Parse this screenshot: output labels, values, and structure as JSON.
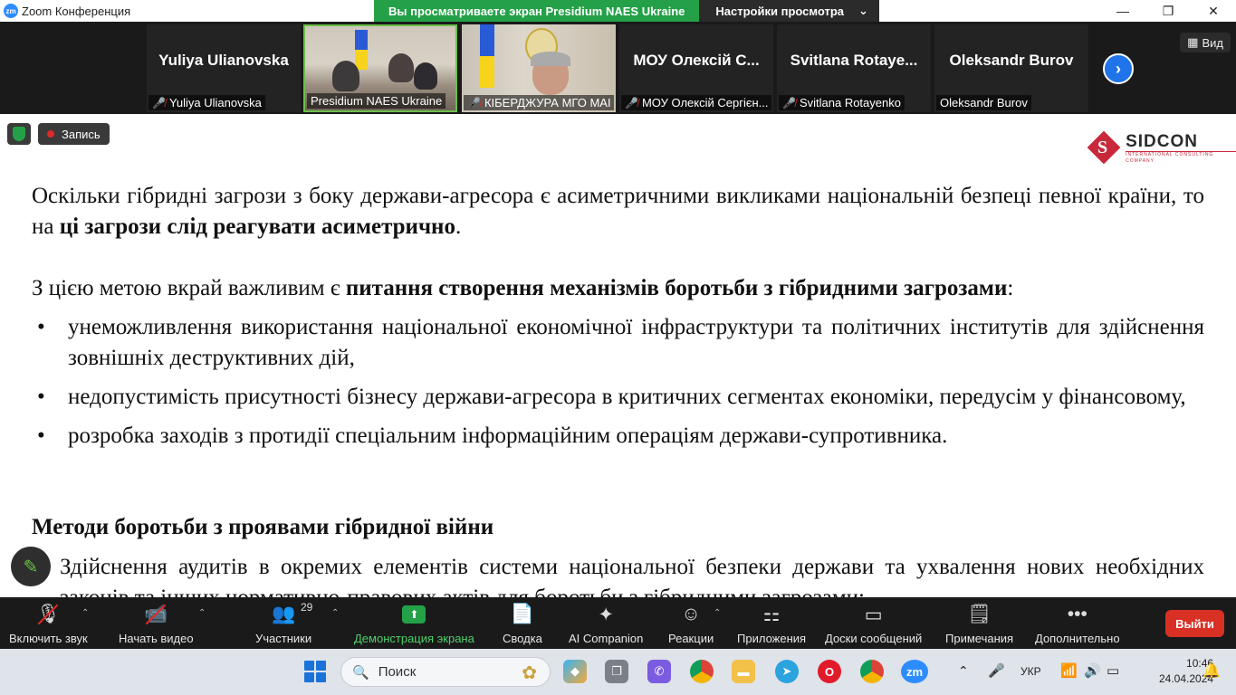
{
  "titlebar": {
    "app_title": "Zoom Конференция",
    "logo_text": "zm",
    "share_banner": "Вы просматриваете экран Presidium NAES Ukraine",
    "view_settings": "Настройки просмотра"
  },
  "video_strip": {
    "tiles": [
      {
        "big_name": "Yuliya Ulianovska",
        "label": "Yuliya Ulianovska",
        "muted": true
      },
      {
        "big_name": "",
        "label": "Presidium NAES Ukraine",
        "muted": false
      },
      {
        "big_name": "",
        "label": "КІБЕРДЖУРА МГО МАІ",
        "muted": true
      },
      {
        "big_name": "МОУ Олексій С...",
        "label": "МОУ Олексій Сергієн...",
        "muted": true
      },
      {
        "big_name": "Svitlana Rotaye...",
        "label": "Svitlana Rotayenko",
        "muted": true
      },
      {
        "big_name": "Oleksandr Burov",
        "label": "Oleksandr Burov",
        "muted": false
      }
    ],
    "view_label": "Вид"
  },
  "badges": {
    "recording": "Запись"
  },
  "logo": {
    "name": "SIDCON",
    "sub": "INTERNATIONAL CONSULTING COMPANY"
  },
  "slide": {
    "p1_a": "Оскільки гібридні загрози з боку держави-агресора є асиметричними викликами національній безпеці певної країни, то на ",
    "p1_b": "ці загрози слід реагувати асиметрично",
    "p1_c": ".",
    "p2_a": "З цією метою вкрай важливим є ",
    "p2_b": "питання створення механізмів боротьби з гібридними загрозами",
    "p2_c": ":",
    "bullets": [
      "унеможливлення використання національної економічної інфраструктури та політичних інститутів для здійснення зовнішніх деструктивних дій,",
      "недопустимість присутності бізнесу держави-агресора в критичних сегментах економіки, передусім у фінансовому,",
      "розробка заходів з протидії спеціальним інформаційним операціям держави-супротивника."
    ],
    "heading": "Методи боротьби з проявами гібридної війни",
    "p3": "Здійснення аудитів в окремих елементів системи національної безпеки держави та ухвалення нових необхідних законів та інших нормативно-правових актів для боротьби з гібридними загрозами;"
  },
  "toolbar": {
    "unmute": "Включить звук",
    "start_video": "Начать видео",
    "participants": "Участники",
    "participants_count": "29",
    "share_screen": "Демонстрация экрана",
    "summary": "Сводка",
    "ai_companion": "AI Companion",
    "reactions": "Реакции",
    "apps": "Приложения",
    "whiteboards": "Доски сообщений",
    "notes": "Примечания",
    "more": "Дополнительно",
    "leave": "Выйти"
  },
  "taskbar": {
    "search_placeholder": "Поиск",
    "language": "УКР",
    "time": "10:46",
    "date": "24.04.2024"
  },
  "colors": {
    "zoom_blue": "#2d8cff",
    "share_green": "#24a148",
    "leave_red": "#d93025"
  }
}
